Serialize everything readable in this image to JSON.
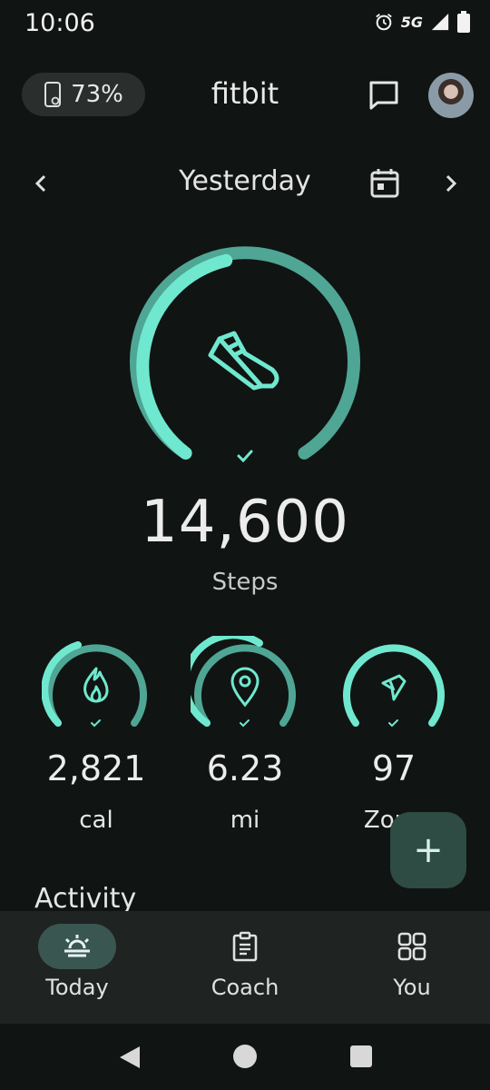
{
  "status_bar": {
    "time": "10:06",
    "network": "5G",
    "icons": [
      "alarm-icon",
      "signal-icon",
      "battery-icon"
    ]
  },
  "header": {
    "device_battery": "73%",
    "app_title": "fitbit",
    "icons": [
      "device-battery-icon",
      "chat-icon",
      "avatar"
    ]
  },
  "date_nav": {
    "label": "Yesterday",
    "icons": [
      "chevron-left-icon",
      "calendar-icon",
      "chevron-right-icon"
    ]
  },
  "steps": {
    "value": "14,600",
    "label": "Steps",
    "goal_progress": 1.0,
    "icon": "shoe-icon"
  },
  "stats": [
    {
      "value": "2,821",
      "unit": "cal",
      "icon": "flame-icon",
      "progress": 1.0
    },
    {
      "value": "6.23",
      "unit": "mi",
      "icon": "location-pin-icon",
      "progress": 1.0
    },
    {
      "value": "97",
      "unit": "Zone",
      "icon": "active-zone-icon",
      "progress": 1.0
    }
  ],
  "fab": {
    "label": "+",
    "icon": "add-icon"
  },
  "section": {
    "heading": "Activity"
  },
  "bottom_nav": {
    "items": [
      {
        "label": "Today",
        "icon": "sunrise-icon",
        "selected": true
      },
      {
        "label": "Coach",
        "icon": "clipboard-icon",
        "selected": false
      },
      {
        "label": "You",
        "icon": "grid-icon",
        "selected": false
      }
    ]
  },
  "colors": {
    "background": "#101412",
    "accent_bright": "#6fe8cf",
    "accent_dim": "#4fa694",
    "surface": "#2a2f2d",
    "nav_selected": "#3a5650"
  }
}
